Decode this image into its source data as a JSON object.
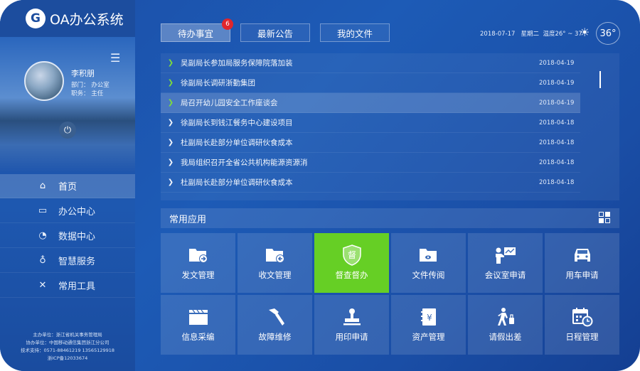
{
  "app": {
    "logo_letter": "G",
    "title": "OA办公系统"
  },
  "profile": {
    "menu_icon": "hamburger-icon",
    "name": "李积朋",
    "department": "部门：  办公室",
    "position": "职务：  主任",
    "power_icon": "power-icon"
  },
  "nav": [
    {
      "label": "首页",
      "icon": "home-icon",
      "glyph": "⌂",
      "active": true
    },
    {
      "label": "办公中心",
      "icon": "briefcase-icon",
      "glyph": "▭",
      "active": false
    },
    {
      "label": "数据中心",
      "icon": "pie-chart-icon",
      "glyph": "◔",
      "active": false
    },
    {
      "label": "智慧服务",
      "icon": "bulb-icon",
      "glyph": "♁",
      "active": false
    },
    {
      "label": "常用工具",
      "icon": "tools-icon",
      "glyph": "✕",
      "active": false
    }
  ],
  "footer": {
    "line1": "主办单位：浙江省机关事务管理局",
    "line2": "协办单位：中国移动通信集团浙江分公司",
    "line3": "技术支持：0571-88461219  13565129918",
    "line4": "浙ICP备12033674"
  },
  "tabs": [
    {
      "label": "待办事宜",
      "active": true
    },
    {
      "label": "最新公告",
      "active": false
    },
    {
      "label": "我的文件",
      "active": false
    }
  ],
  "badge_count": "6",
  "status": {
    "date": "2018-07-17",
    "weekday": "星期二",
    "temp_range": "温度26° ~ 37°",
    "weather_icon": "sun-icon",
    "temperature": "36°"
  },
  "news": [
    {
      "title": "吴副局长参加局服务保障院落加装",
      "date": "2018-04-19",
      "new": true,
      "highlight": false
    },
    {
      "title": "徐副局长调研浙勤集团",
      "date": "2018-04-19",
      "new": true,
      "highlight": false
    },
    {
      "title": "局召开幼儿园安全工作座谈会",
      "date": "2018-04-19",
      "new": true,
      "highlight": true
    },
    {
      "title": "徐副局长到钱江餐务中心建设项目",
      "date": "2018-04-18",
      "new": false,
      "highlight": false
    },
    {
      "title": "杜副局长赴部分单位调研伙食成本",
      "date": "2018-04-18",
      "new": false,
      "highlight": false
    },
    {
      "title": "我局组织召开全省公共机构能源资源消",
      "date": "2018-04-18",
      "new": false,
      "highlight": false
    },
    {
      "title": "杜副局长赴部分单位调研伙食成本",
      "date": "2018-04-18",
      "new": false,
      "highlight": false
    }
  ],
  "apps_section": {
    "title": "常用应用",
    "layout_icon": "grid-layout-icon"
  },
  "apps": [
    {
      "label": "发文管理",
      "icon": "folder-send-icon",
      "active": false
    },
    {
      "label": "收文管理",
      "icon": "folder-receive-icon",
      "active": false
    },
    {
      "label": "督查督办",
      "icon": "supervise-badge-icon",
      "icon_text": "督",
      "active": true
    },
    {
      "label": "文件传阅",
      "icon": "folder-view-icon",
      "active": false
    },
    {
      "label": "会议室申请",
      "icon": "presentation-icon",
      "active": false
    },
    {
      "label": "用车申请",
      "icon": "car-icon",
      "active": false
    },
    {
      "label": "信息采编",
      "icon": "clapperboard-icon",
      "active": false
    },
    {
      "label": "故障维修",
      "icon": "hammer-icon",
      "active": false
    },
    {
      "label": "用印申请",
      "icon": "stamp-icon",
      "active": false
    },
    {
      "label": "资产管理",
      "icon": "ledger-icon",
      "icon_text": "¥",
      "active": false
    },
    {
      "label": "请假出差",
      "icon": "traveler-icon",
      "active": false
    },
    {
      "label": "日程管理",
      "icon": "calendar-clock-icon",
      "active": false
    }
  ]
}
